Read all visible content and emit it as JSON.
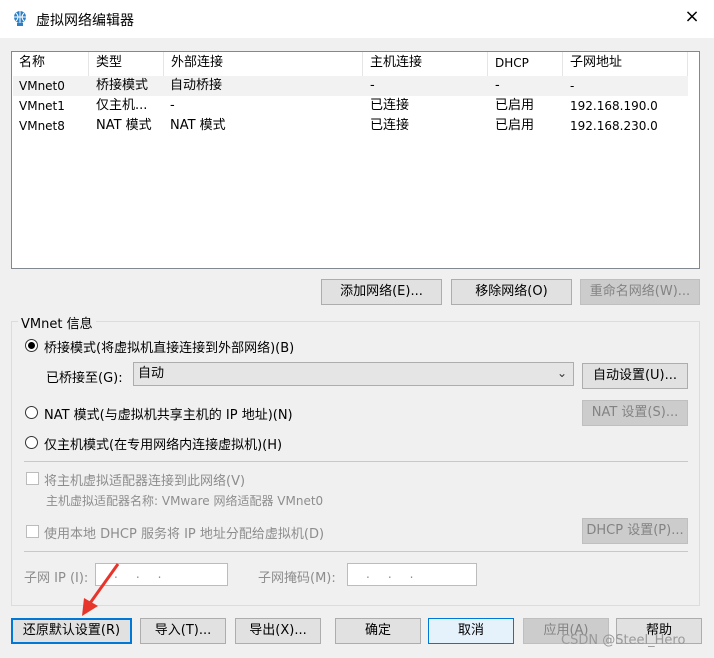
{
  "window": {
    "title": "虚拟网络编辑器",
    "close_icon": "×"
  },
  "table": {
    "headers": [
      "名称",
      "类型",
      "外部连接",
      "主机连接",
      "DHCP",
      "子网地址"
    ],
    "rows": [
      [
        "VMnet0",
        "桥接模式",
        "自动桥接",
        "-",
        "-",
        "-"
      ],
      [
        "VMnet1",
        "仅主机...",
        "-",
        "已连接",
        "已启用",
        "192.168.190.0"
      ],
      [
        "VMnet8",
        "NAT 模式",
        "NAT 模式",
        "已连接",
        "已启用",
        "192.168.230.0"
      ]
    ]
  },
  "list_buttons": {
    "add": "添加网络(E)...",
    "remove": "移除网络(O)",
    "rename": "重命名网络(W)..."
  },
  "vmnet_info": {
    "label": "VMnet 信息",
    "bridge_radio": "桥接模式(将虚拟机直接连接到外部网络)(B)",
    "bridged_to_label": "已桥接至(G):",
    "bridged_to_value": "自动",
    "auto_settings": "自动设置(U)...",
    "nat_radio": "NAT 模式(与虚拟机共享主机的 IP 地址)(N)",
    "nat_settings": "NAT 设置(S)...",
    "hostonly_radio": "仅主机模式(在专用网络内连接虚拟机)(H)",
    "connect_adapter": "将主机虚拟适配器连接到此网络(V)",
    "adapter_name": "主机虚拟适配器名称: VMware 网络适配器 VMnet0",
    "dhcp_check": "使用本地 DHCP 服务将 IP 地址分配给虚拟机(D)",
    "dhcp_settings": "DHCP 设置(P)...",
    "subnet_ip_label": "子网 IP (I):",
    "subnet_mask_label": "子网掩码(M):",
    "ip_dots": "...",
    "mask_dots": "..."
  },
  "footer": {
    "restore": "还原默认设置(R)",
    "import": "导入(T)...",
    "export": "导出(X)...",
    "ok": "确定",
    "cancel": "取消",
    "apply": "应用(A)",
    "help": "帮助"
  },
  "watermark": "CSDN @Steel_Hero",
  "colors": {
    "accent": "#0078d7",
    "annotation_arrow": "#e8352b"
  }
}
